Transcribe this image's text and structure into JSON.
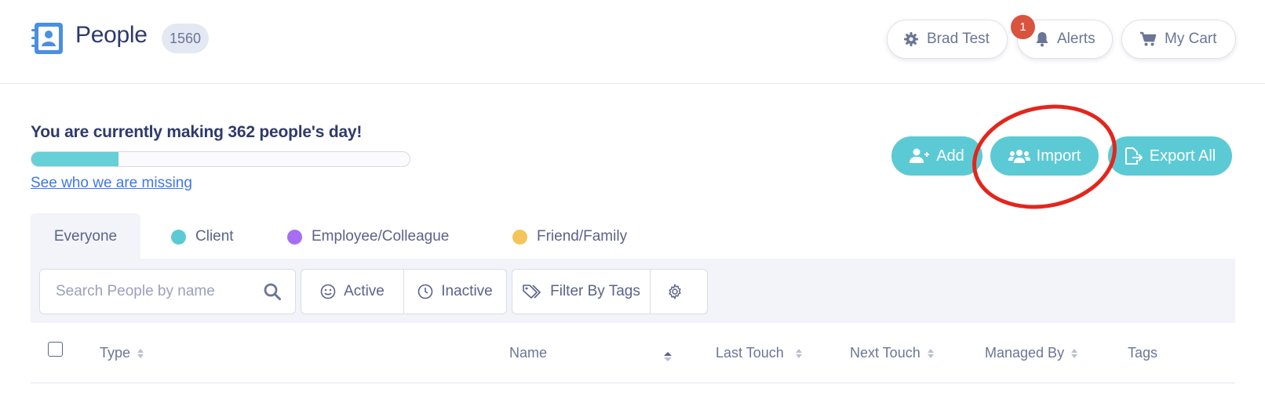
{
  "header": {
    "title": "People",
    "count": "1560",
    "user_label": "Brad Test",
    "alerts_label": "Alerts",
    "alerts_count": "1",
    "cart_label": "My Cart"
  },
  "banner": {
    "message": "You are currently making 362 people's day!",
    "progress": 0.23,
    "link": "See who we are missing"
  },
  "actions": {
    "add": "Add",
    "import": "Import",
    "export": "Export All"
  },
  "tabs": [
    {
      "label": "Everyone",
      "color": null
    },
    {
      "label": "Client",
      "color": "#5ccad4"
    },
    {
      "label": "Employee/Colleague",
      "color": "#a66ef2"
    },
    {
      "label": "Friend/Family",
      "color": "#f3c55a"
    }
  ],
  "filters": {
    "search_placeholder": "Search People by name",
    "active": "Active",
    "inactive": "Inactive",
    "tags": "Filter By Tags"
  },
  "table": {
    "columns": [
      "Type",
      "Name",
      "Last Touch",
      "Next Touch",
      "Managed By",
      "Tags"
    ]
  },
  "colors": {
    "accent": "#5ccad4",
    "alert_badge": "#d9533f",
    "annotation_circle": "#e3261c",
    "link": "#3f77e6"
  }
}
